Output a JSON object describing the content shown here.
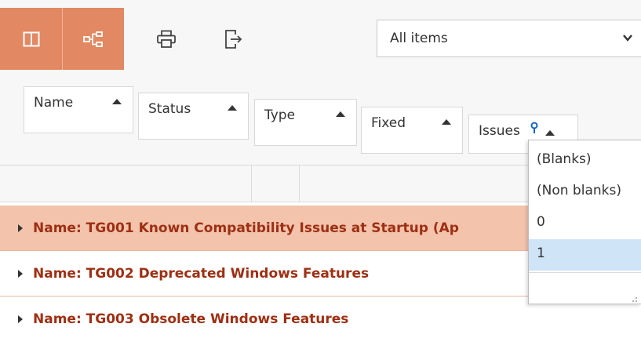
{
  "toolbar": {
    "buttons": [
      {
        "name": "columns-view-button",
        "icon": "columns-icon",
        "active": true
      },
      {
        "name": "tree-view-button",
        "icon": "hierarchy-icon",
        "active": true
      },
      {
        "name": "print-button",
        "icon": "printer-icon",
        "active": false
      },
      {
        "name": "export-button",
        "icon": "export-icon",
        "active": false
      }
    ],
    "view_select": {
      "value": "All items",
      "icon": "chevron-down-icon"
    },
    "accent_color": "#e28862"
  },
  "group_by": [
    {
      "label": "Name",
      "icon": "sort-up-icon"
    },
    {
      "label": "Status",
      "icon": "sort-up-icon"
    },
    {
      "label": "Type",
      "icon": "sort-up-icon"
    },
    {
      "label": "Fixed",
      "icon": "sort-up-icon"
    },
    {
      "label": "Issues",
      "icon": "sort-up-icon",
      "filter_icon": "filter-icon"
    }
  ],
  "groups": [
    {
      "label": "Name: TG001 Known Compatibility Issues at Startup (Ap",
      "selected": true
    },
    {
      "label": "Name: TG002 Deprecated Windows Features",
      "selected": false
    },
    {
      "label": "Name: TG003 Obsolete Windows Features",
      "selected": false
    }
  ],
  "filter_popup": {
    "options": [
      "(Blanks)",
      "(Non blanks)",
      "0",
      "1"
    ],
    "highlighted": "1"
  },
  "colors": {
    "group_text": "#9e2f13",
    "selected_row": "#f3c3ac",
    "highlight": "#cfe4f7"
  }
}
